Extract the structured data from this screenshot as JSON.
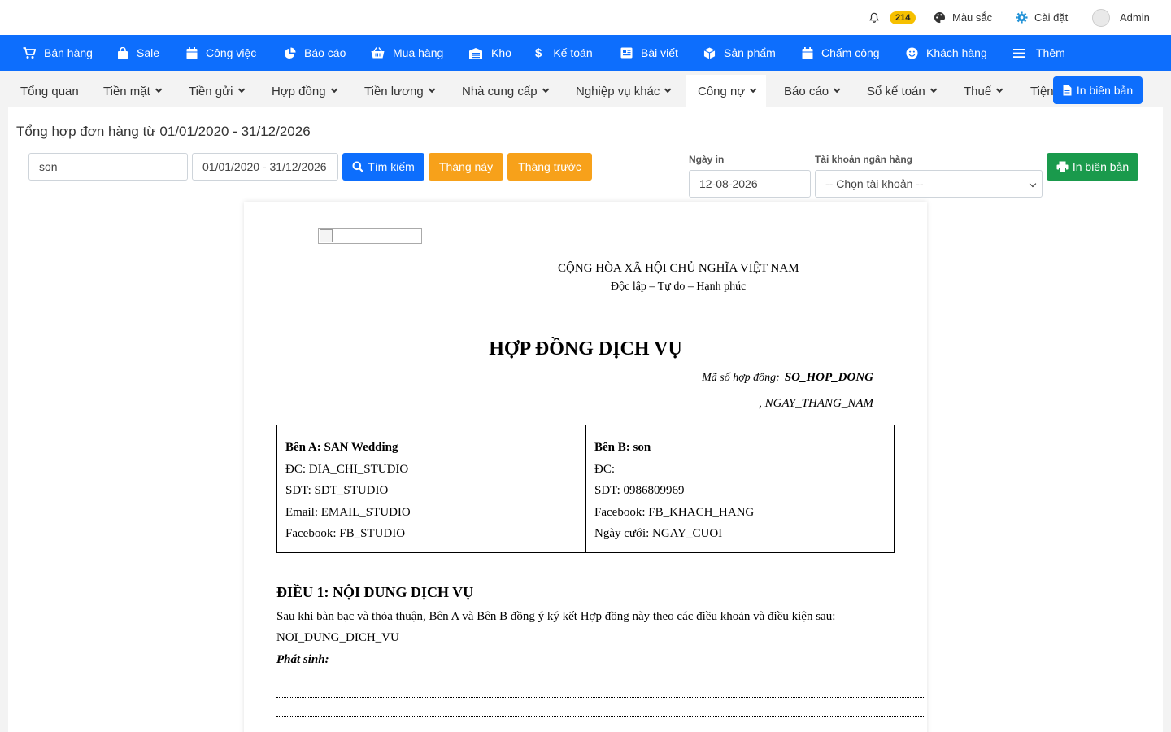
{
  "topbar": {
    "notifications_count": "214",
    "colors_label": "Màu sắc",
    "settings_label": "Cài đặt",
    "user_name": "Admin"
  },
  "main_nav": [
    {
      "label": "Bán hàng",
      "icon": "cart-icon"
    },
    {
      "label": "Sale",
      "icon": "bag-icon"
    },
    {
      "label": "Công việc",
      "icon": "calendar-icon"
    },
    {
      "label": "Báo cáo",
      "icon": "pie-chart-icon"
    },
    {
      "label": "Mua hàng",
      "icon": "basket-icon"
    },
    {
      "label": "Kho",
      "icon": "warehouse-icon"
    },
    {
      "label": "Kế toán",
      "icon": "dollar-icon"
    },
    {
      "label": "Bài viết",
      "icon": "article-icon"
    },
    {
      "label": "Sản phẩm",
      "icon": "cube-icon"
    },
    {
      "label": "Chấm công",
      "icon": "calendar-icon"
    },
    {
      "label": "Khách hàng",
      "icon": "smile-icon"
    },
    {
      "label": "Thêm",
      "icon": "menu-icon"
    }
  ],
  "sub_nav": [
    {
      "label": "Tổng quan"
    },
    {
      "label": "Tiền mặt"
    },
    {
      "label": "Tiền gửi"
    },
    {
      "label": "Hợp đồng"
    },
    {
      "label": "Tiền lương"
    },
    {
      "label": "Nhà cung cấp"
    },
    {
      "label": "Nghiệp vụ khác"
    },
    {
      "label": "Công nợ"
    },
    {
      "label": "Báo cáo"
    },
    {
      "label": "Sổ kế toán"
    },
    {
      "label": "Thuế"
    },
    {
      "label": "Tiện"
    }
  ],
  "print_top_label": "In biên bản",
  "page_title": "Tổng hợp đơn hàng từ 01/01/2020 - 31/12/2026",
  "filters": {
    "search_value": "son",
    "date_range_value": "01/01/2020 - 31/12/2026",
    "search_button": "Tìm kiếm",
    "this_month_button": "Tháng này",
    "last_month_button": "Tháng trước",
    "print_date_label": "Ngày in",
    "print_date_value": "12-08-2026",
    "bank_account_label": "Tài khoản ngân hàng",
    "bank_account_selected": "-- Chọn tài khoản --",
    "print_button": "In biên bản"
  },
  "document": {
    "republic": "CỘNG HÒA XÃ HỘI CHỦ NGHĨA VIỆT NAM",
    "motto": "Độc lập – Tự do – Hạnh phúc",
    "title": "HỢP ĐỒNG DỊCH VỤ",
    "contract_code_label": "Mã số hợp đồng:",
    "contract_code_value": "SO_HOP_DONG",
    "date_line": ", NGAY_THANG_NAM",
    "party_a": {
      "heading": "Bên A: SAN Wedding",
      "address": "ĐC: DIA_CHI_STUDIO",
      "phone": "SĐT: SDT_STUDIO",
      "email": "Email: EMAIL_STUDIO",
      "facebook": "Facebook: FB_STUDIO"
    },
    "party_b": {
      "heading": "Bên B: son",
      "address": "ĐC:",
      "phone": "SĐT: 0986809969",
      "facebook": "Facebook: FB_KHACH_HANG",
      "wedding_date": "Ngày cưới: NGAY_CUOI"
    },
    "article1_title": "ĐIỀU 1: NỘI DUNG DỊCH VỤ",
    "article1_intro": "Sau khi bàn bạc và thỏa thuận, Bên A và Bên B đồng ý ký kết Hợp đồng này theo các điều khoản và điều kiện sau:",
    "article1_content": "NOI_DUNG_DICH_VU",
    "arising_label": "Phát sinh:"
  },
  "colors": {
    "primary": "#0d6efd",
    "warning": "#f7a11a",
    "success": "#1a9a4c",
    "badge": "#f6c000"
  }
}
